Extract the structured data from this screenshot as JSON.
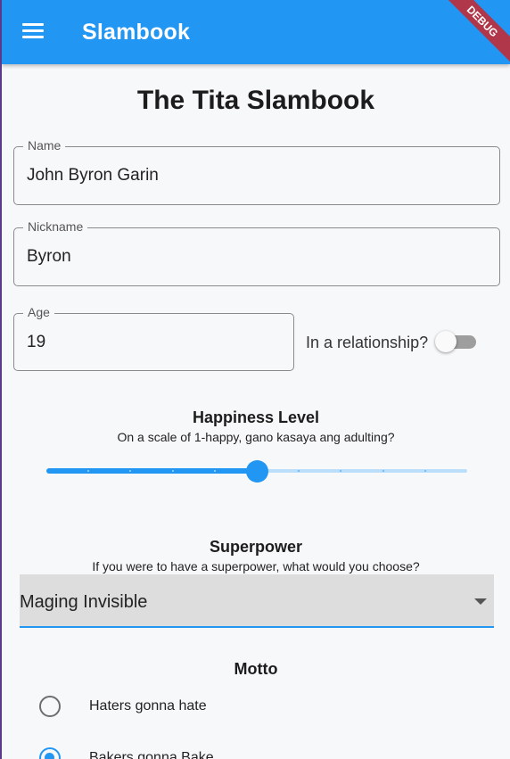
{
  "app": {
    "title": "Slambook",
    "debug_banner": "DEBUG",
    "menu_icon": "menu-icon"
  },
  "page": {
    "title": "The Tita Slambook"
  },
  "form": {
    "name": {
      "label": "Name",
      "value": "John Byron Garin"
    },
    "nickname": {
      "label": "Nickname",
      "value": "Byron"
    },
    "age": {
      "label": "Age",
      "value": "19"
    },
    "relationship": {
      "label": "In a relationship?",
      "on": false
    }
  },
  "happiness": {
    "title": "Happiness Level",
    "subtitle": "On a scale of 1-happy, gano kasaya ang adulting?",
    "min": 0,
    "max": 10,
    "value": 5
  },
  "superpower": {
    "title": "Superpower",
    "subtitle": "If you were to have a superpower, what would you choose?",
    "selected": "Maging Invisible"
  },
  "motto": {
    "title": "Motto",
    "options": [
      {
        "label": "Haters gonna hate",
        "selected": false
      },
      {
        "label": "Bakers gonna Bake",
        "selected": true
      }
    ]
  },
  "colors": {
    "primary": "#2196f3",
    "primary_light": "#bbdefb",
    "debug": "#b0364a"
  }
}
